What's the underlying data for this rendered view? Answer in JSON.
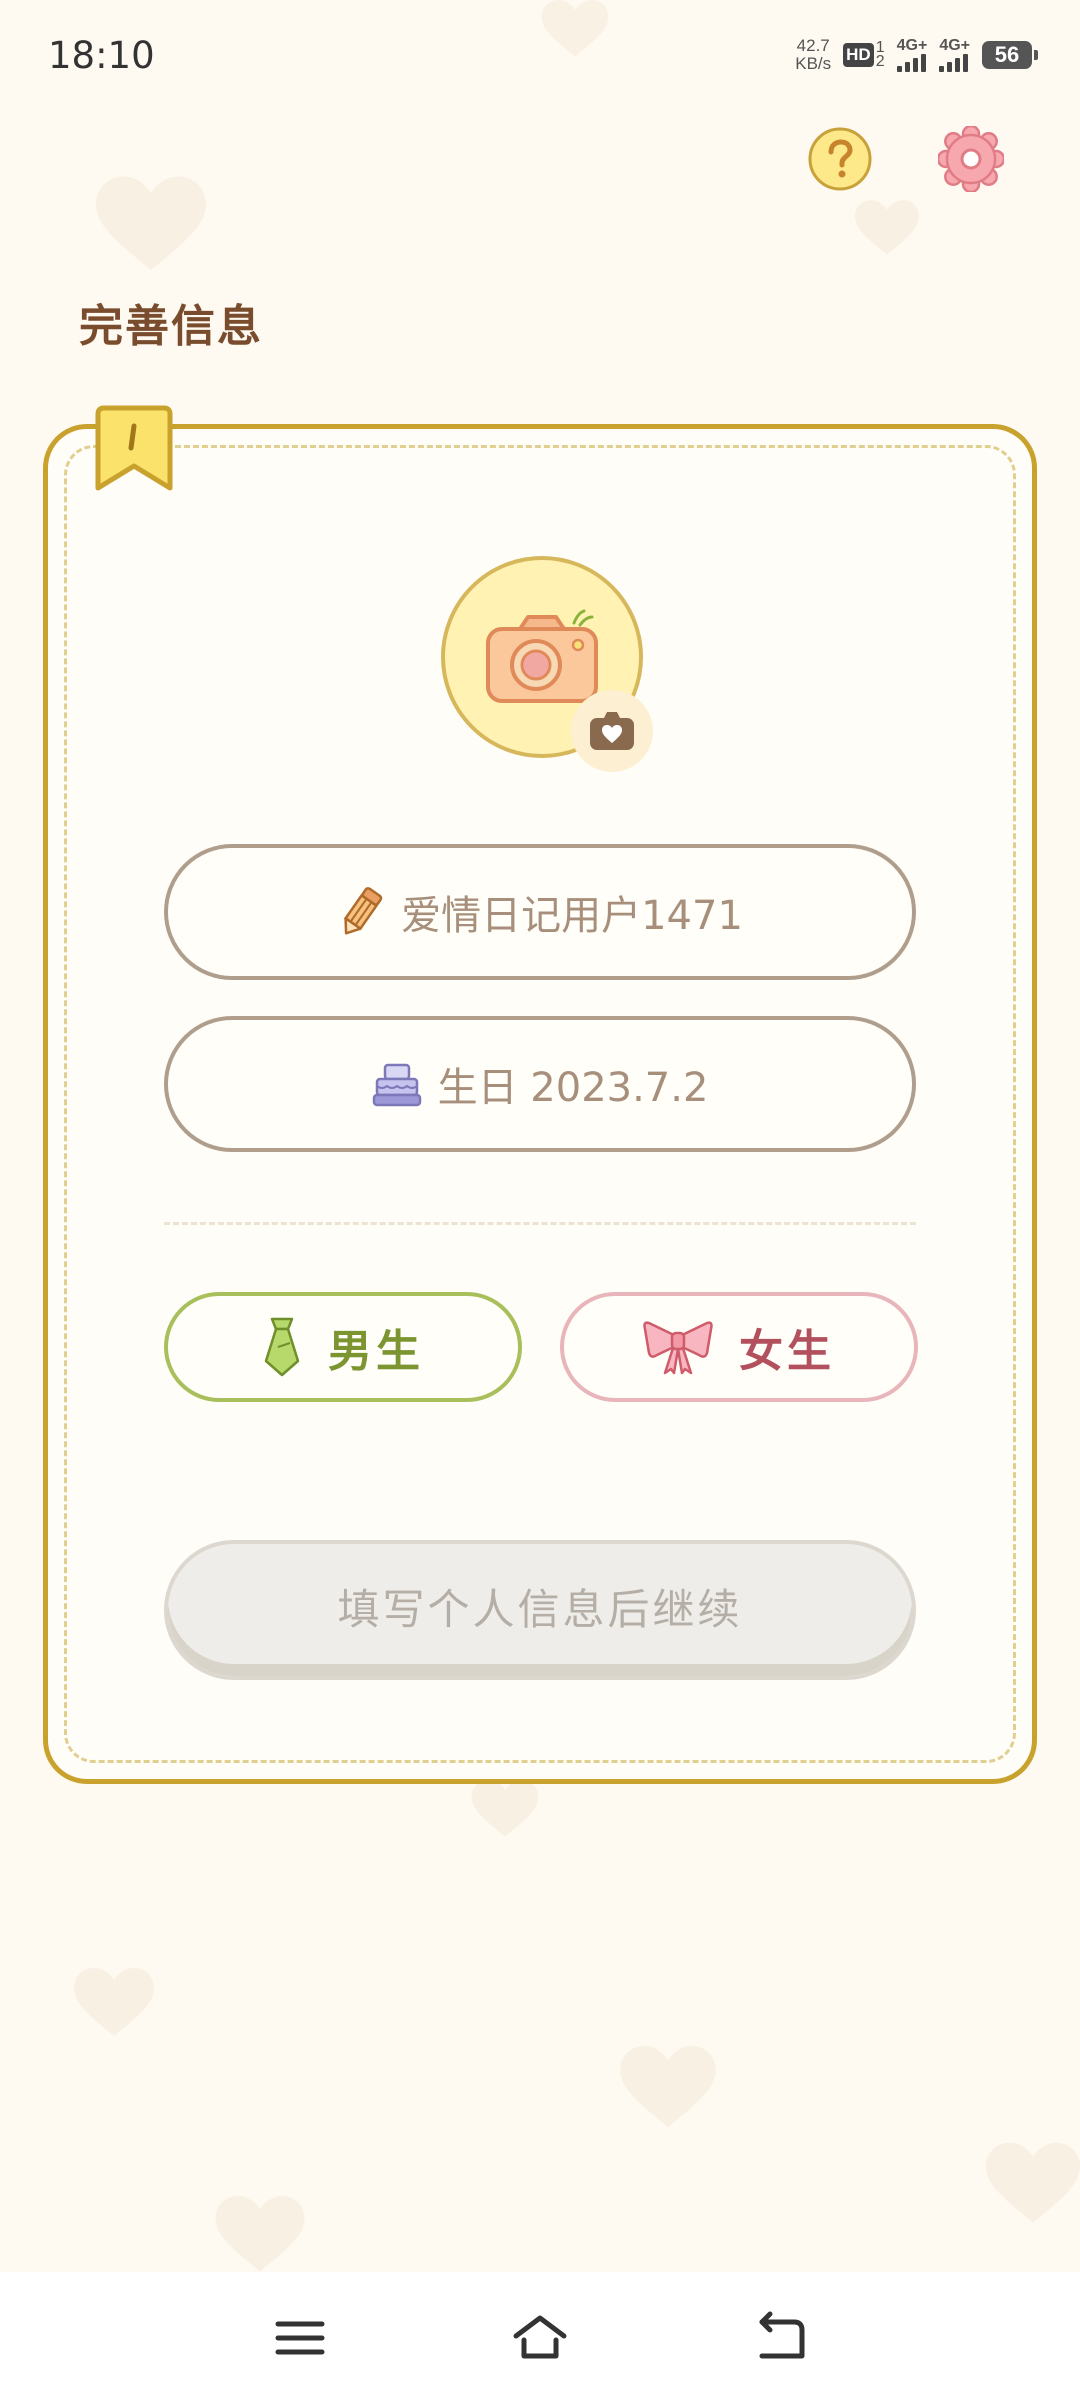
{
  "status_bar": {
    "time": "18:10",
    "net_speed_value": "42.7",
    "net_speed_unit": "KB/s",
    "hd_label": "HD",
    "hd_sim_top": "1",
    "hd_sim_bottom": "2",
    "signal1_label": "4G+",
    "signal2_label": "4G+",
    "battery": "56"
  },
  "header": {
    "help_icon": "question-icon",
    "settings_icon": "gear-icon"
  },
  "page": {
    "title": "完善信息"
  },
  "form": {
    "avatar_icon": "camera-icon",
    "avatar_badge_icon": "camera-heart-icon",
    "nickname_icon": "pencil-icon",
    "nickname_value": "爱情日记用户1471",
    "birthday_icon": "cake-icon",
    "birthday_value": "生日 2023.7.2",
    "gender": {
      "male_icon": "tie-icon",
      "male_label": "男生",
      "female_icon": "bow-icon",
      "female_label": "女生"
    },
    "continue_label": "填写个人信息后继续"
  },
  "nav_bar": {
    "menu_icon": "menu-icon",
    "home_icon": "home-icon",
    "back_icon": "back-icon"
  },
  "colors": {
    "background": "#fef9f1",
    "card_border": "#c9a22d",
    "male_accent": "#a8bf5b",
    "female_accent": "#e8b5bb",
    "title_brown": "#7a4c2e"
  }
}
